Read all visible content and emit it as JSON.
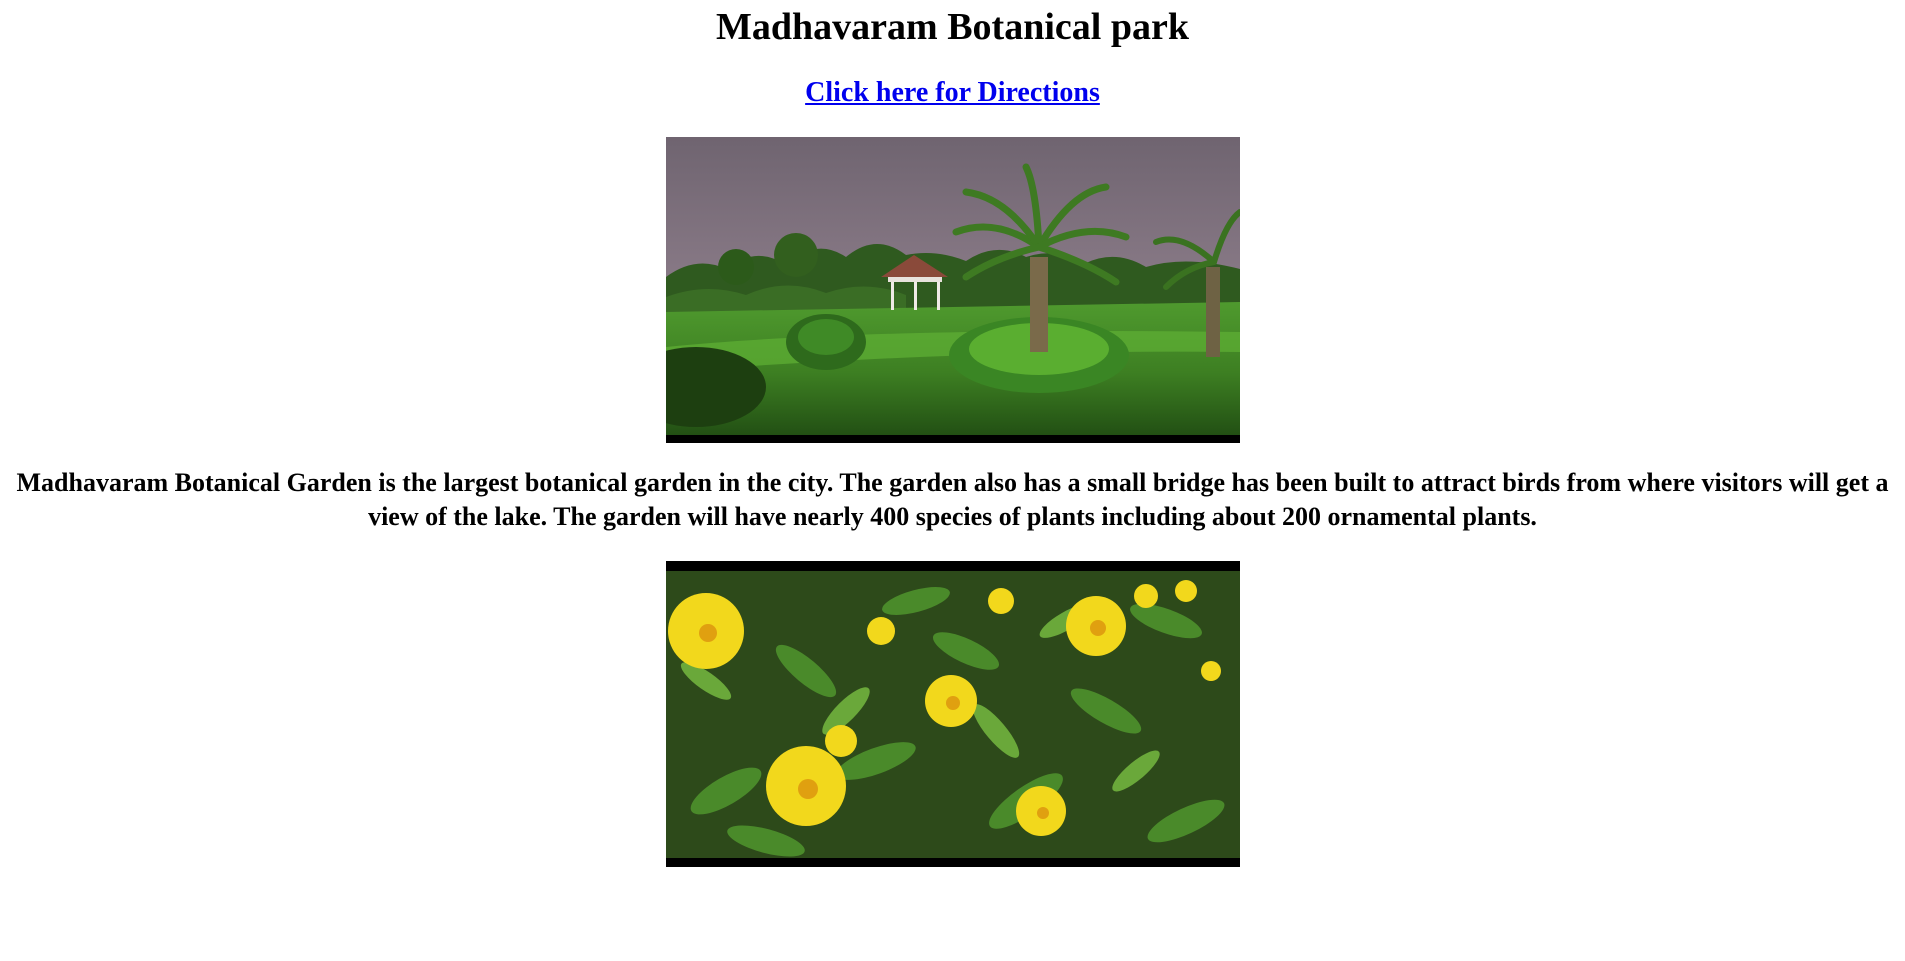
{
  "page": {
    "title": "Madhavaram Botanical park",
    "directions_link": "Click here for Directions",
    "description": "Madhavaram Botanical Garden is the largest botanical garden in the city. The garden also has a small bridge has been built to attract birds from where visitors will get a view of the lake. The garden will have nearly 400 species of plants including about 200 ornamental plants."
  },
  "colors": {
    "link": "#0000ee",
    "text": "#000000",
    "background": "#ffffff"
  },
  "images": {
    "park": "garden-landscape-photo",
    "flowers": "yellow-flowers-photo"
  }
}
